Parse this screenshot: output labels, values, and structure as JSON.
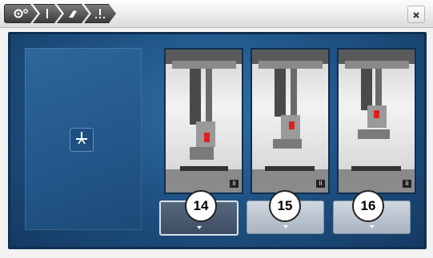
{
  "breadcrumb": {
    "items": [
      {
        "icon": "settings-icon"
      },
      {
        "icon": "needle-icon"
      },
      {
        "icon": "presser-foot-icon"
      },
      {
        "icon": "needle-position-icon"
      }
    ]
  },
  "close": {
    "icon": "close-icon"
  },
  "left_panel": {
    "icon": "presser-foot-selected-icon"
  },
  "options": [
    {
      "callout": "14",
      "info_icon": "info-icon",
      "arrow_icon": "chevron-down-icon",
      "selected": true
    },
    {
      "callout": "15",
      "info_icon": "info-icon",
      "arrow_icon": "chevron-down-icon",
      "selected": false
    },
    {
      "callout": "16",
      "info_icon": "info-icon",
      "arrow_icon": "chevron-down-icon",
      "selected": false
    }
  ],
  "colors": {
    "panel_blue": "#1f5283",
    "panel_dark": "#0f2f52",
    "active_button": "#4a5a6e",
    "inactive_button": "#b8c2cc",
    "marker_red": "#e02020"
  }
}
